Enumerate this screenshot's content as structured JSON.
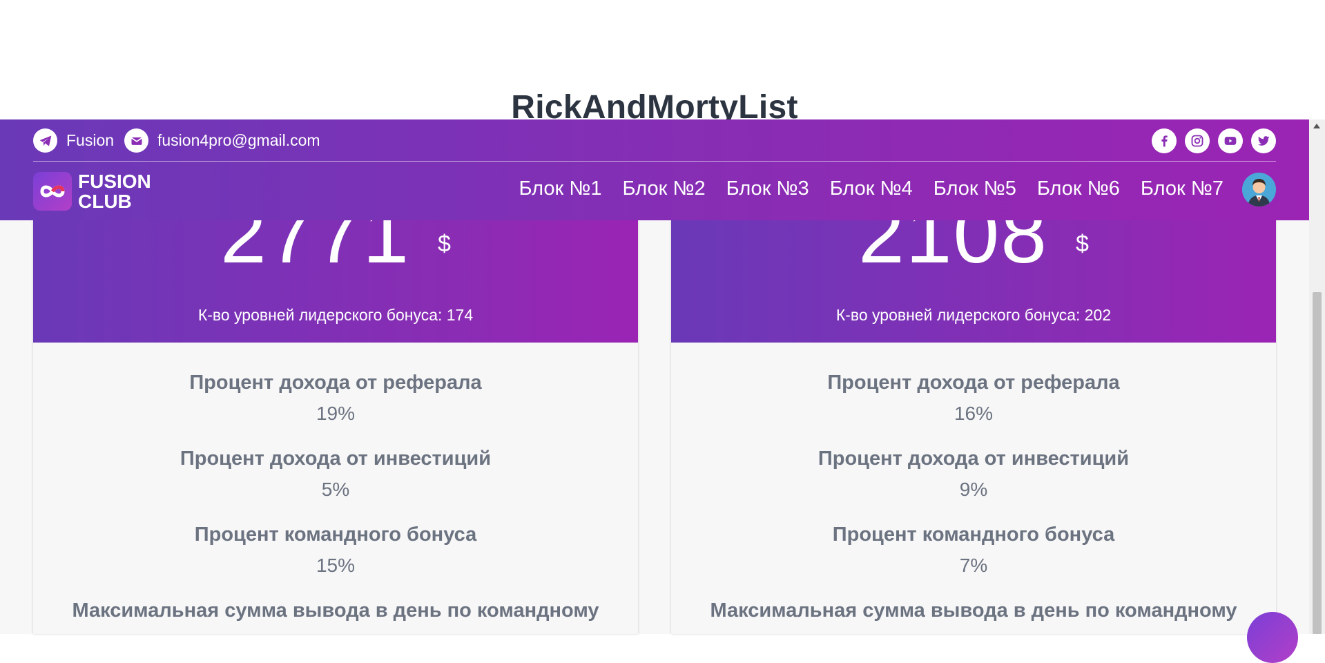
{
  "page_title": "RickAndMortyList",
  "topbar": {
    "telegram_label": "Fusion",
    "email_label": "fusion4pro@gmail.com",
    "socials": [
      "facebook-icon",
      "instagram-icon",
      "youtube-icon",
      "twitter-icon"
    ]
  },
  "logo": {
    "line1": "FUSION",
    "line2": "CLUB"
  },
  "nav": [
    "Блок №1",
    "Блок №2",
    "Блок №3",
    "Блок №4",
    "Блок №5",
    "Блок №6",
    "Блок №7"
  ],
  "cards": [
    {
      "price": "2771",
      "currency": "$",
      "levels_text": "К-во уровней лидерского бонуса: 174",
      "stats": [
        {
          "label": "Процент дохода от реферала",
          "value": "19%"
        },
        {
          "label": "Процент дохода от инвестиций",
          "value": "5%"
        },
        {
          "label": "Процент командного бонуса",
          "value": "15%"
        },
        {
          "label": "Максимальная сумма вывода в день по командному",
          "value": ""
        }
      ]
    },
    {
      "price": "2108",
      "currency": "$",
      "levels_text": "К-во уровней лидерского бонуса: 202",
      "stats": [
        {
          "label": "Процент дохода от реферала",
          "value": "16%"
        },
        {
          "label": "Процент дохода от инвестиций",
          "value": "9%"
        },
        {
          "label": "Процент командного бонуса",
          "value": "7%"
        },
        {
          "label": "Максимальная сумма вывода в день по командному",
          "value": ""
        }
      ]
    }
  ],
  "colors": {
    "brand_start": "#6a39b8",
    "brand_end": "#9b24b4",
    "text_muted": "#6b7280"
  }
}
